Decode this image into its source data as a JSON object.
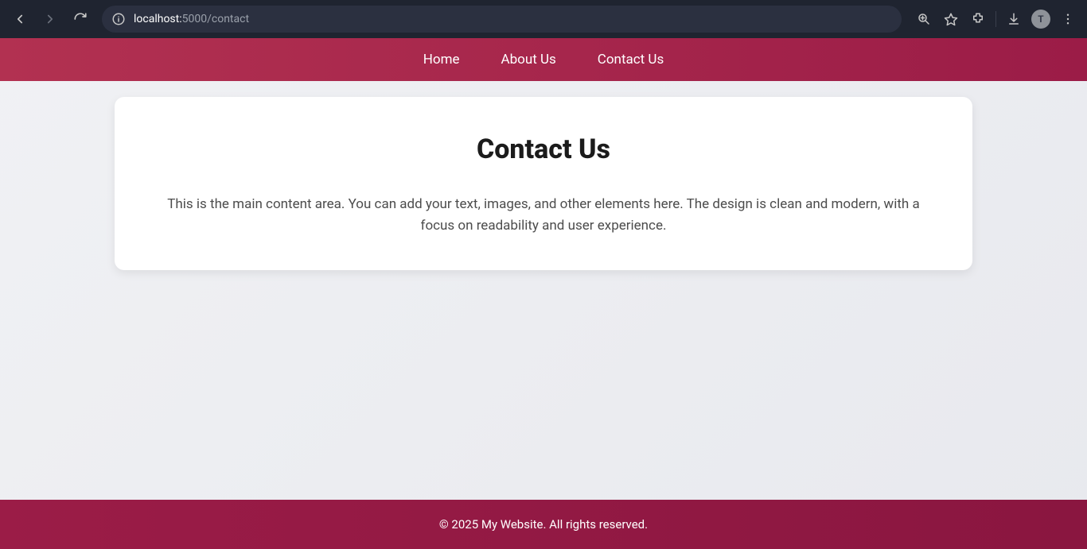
{
  "browser": {
    "url_host": "localhost:",
    "url_rest": "5000/contact",
    "avatar_letter": "T"
  },
  "nav": {
    "items": [
      {
        "label": "Home"
      },
      {
        "label": "About Us"
      },
      {
        "label": "Contact Us"
      }
    ]
  },
  "main": {
    "heading": "Contact Us",
    "body": "This is the main content area. You can add your text, images, and other elements here. The design is clean and modern, with a focus on readability and user experience."
  },
  "footer": {
    "text": "© 2025 My Website. All rights reserved."
  }
}
